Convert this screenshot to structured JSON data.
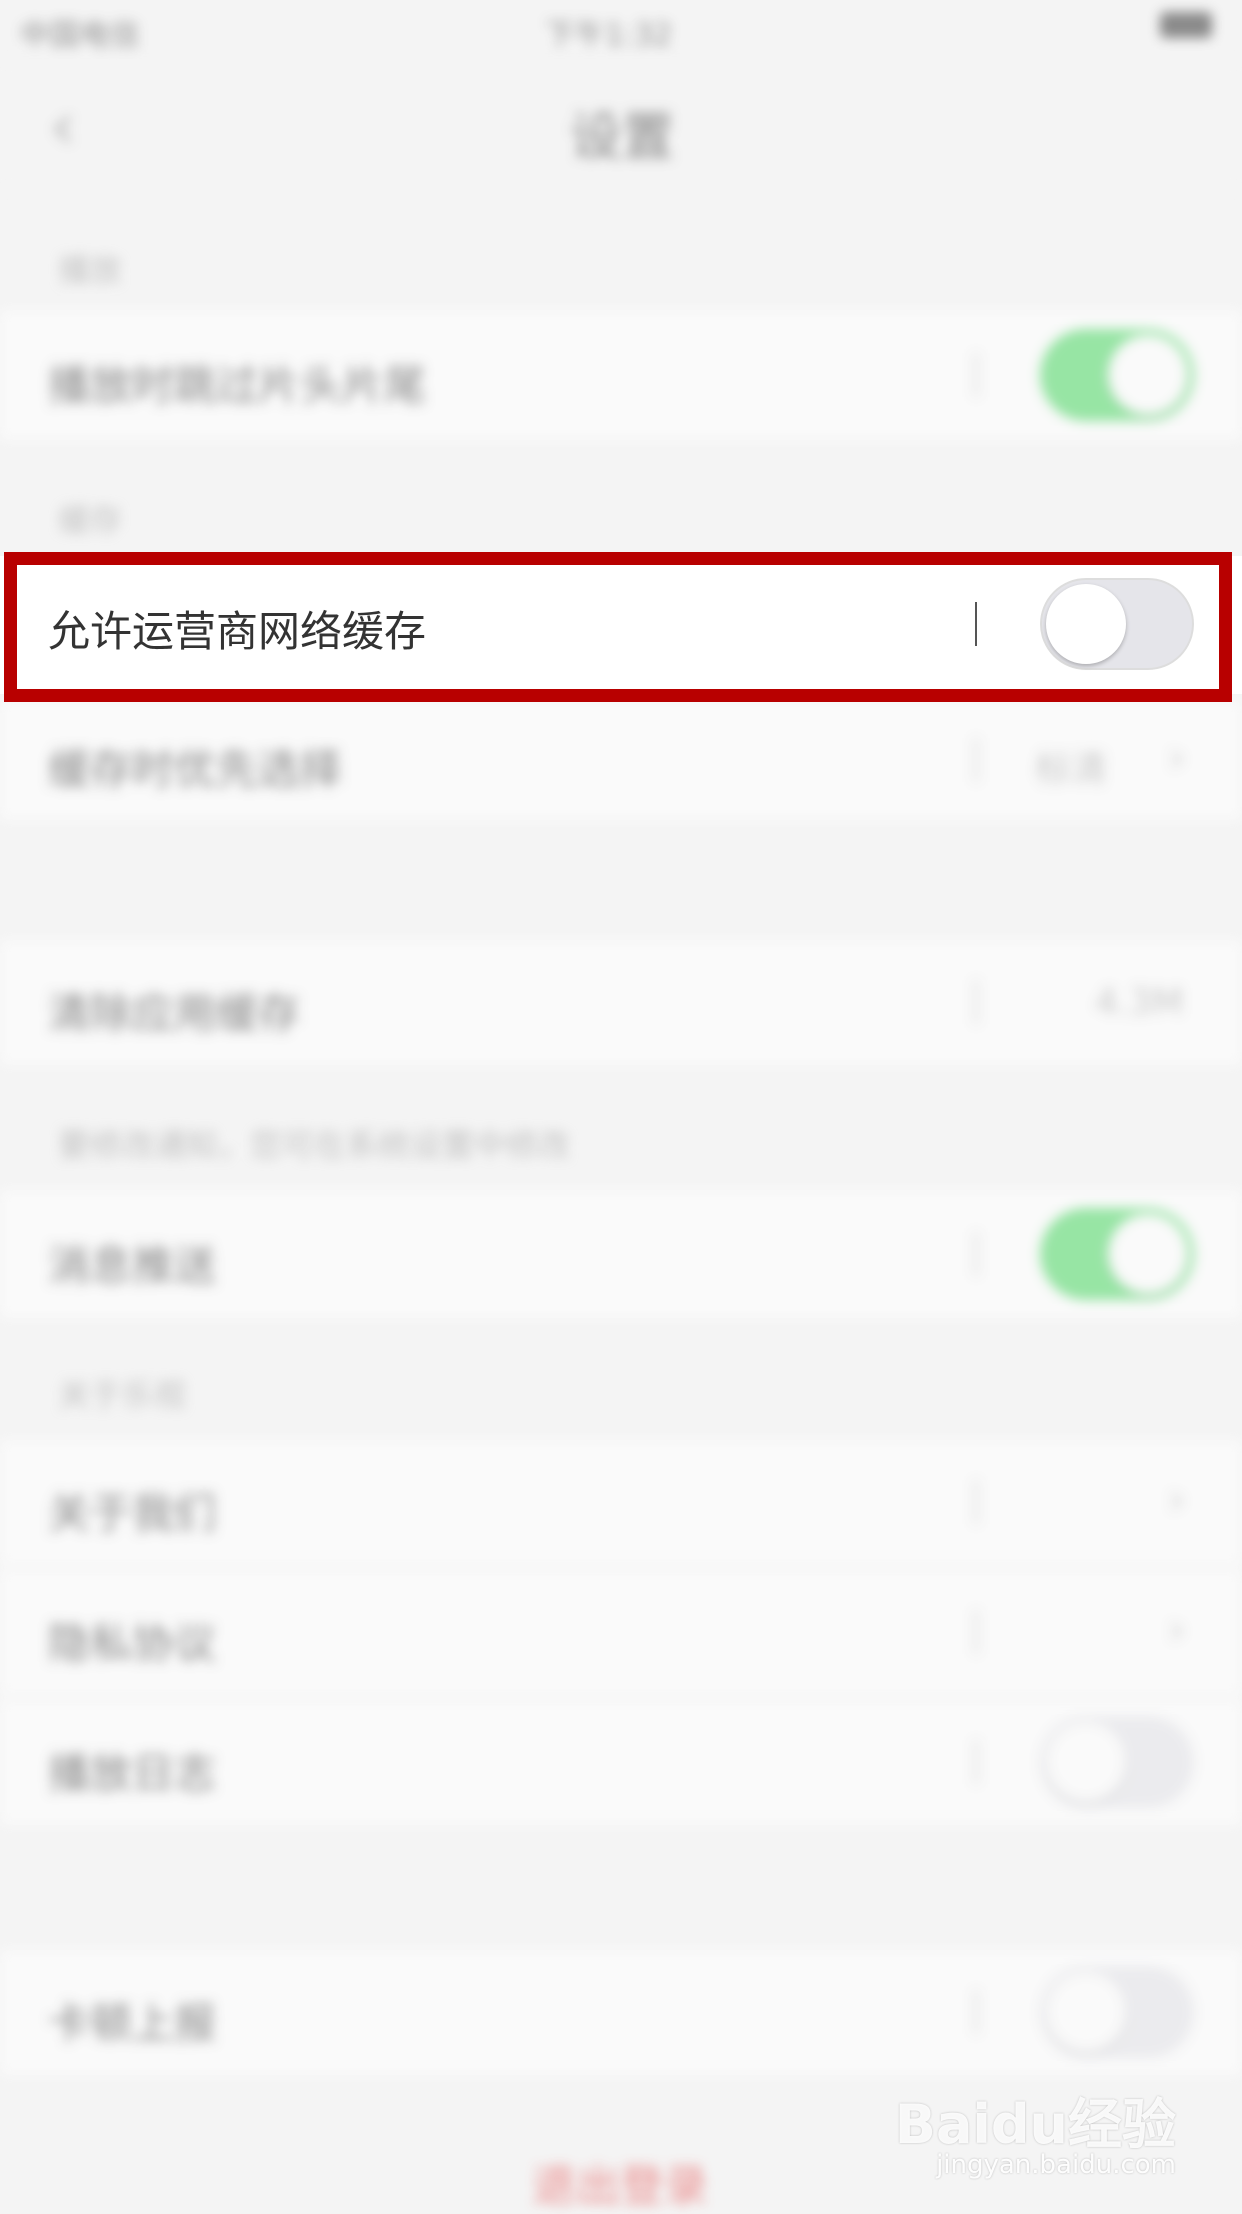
{
  "status_bar": {
    "carrier": "中国电信",
    "time": "下午1:32"
  },
  "nav": {
    "back_icon": "chevron-left-icon",
    "title": "设置"
  },
  "sections": [
    {
      "title": "播放",
      "rows": [
        {
          "label": "播放时跳过片头片尾",
          "control": "toggle",
          "on": true
        }
      ]
    },
    {
      "title": "缓存",
      "rows": [
        {
          "label": "允许运营商网络缓存",
          "control": "toggle",
          "on": false
        },
        {
          "label": "缓存时优先选择",
          "control": "value-chevron",
          "value": "标清"
        }
      ]
    },
    {
      "title": "",
      "rows": [
        {
          "label": "清除应用缓存",
          "control": "value",
          "value": "4.3M"
        }
      ]
    },
    {
      "title": "要修改通知，您可在系统设置中修改",
      "rows": [
        {
          "label": "消息推送",
          "control": "toggle",
          "on": true
        }
      ]
    },
    {
      "title": "关于乐视",
      "rows": [
        {
          "label": "关于我们",
          "control": "chevron"
        },
        {
          "label": "隐私协议",
          "control": "chevron"
        },
        {
          "label": "播放日志",
          "control": "toggle",
          "on": false
        }
      ]
    },
    {
      "title": "",
      "rows": [
        {
          "label": "卡顿上报",
          "control": "toggle",
          "on": false
        }
      ]
    }
  ],
  "logout_label": "退出登录",
  "watermark": {
    "brand": "Baidu经验",
    "url": "jingyan.baidu.com"
  },
  "colors": {
    "toggle_on": "#4cd964",
    "highlight": "#b80000",
    "logout": "#e23b3b"
  }
}
